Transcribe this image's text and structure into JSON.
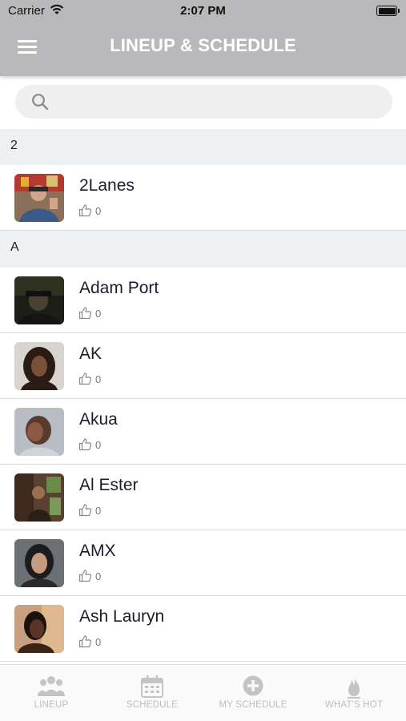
{
  "status_bar": {
    "carrier": "Carrier",
    "time": "2:07 PM"
  },
  "header": {
    "title": "LINEUP & SCHEDULE",
    "menu_icon": "hamburger-menu-icon"
  },
  "search": {
    "placeholder": "",
    "value": ""
  },
  "sections": [
    {
      "letter": "2",
      "artists": [
        {
          "name": "2Lanes",
          "likes": "0"
        }
      ]
    },
    {
      "letter": "A",
      "artists": [
        {
          "name": "Adam Port",
          "likes": "0"
        },
        {
          "name": "AK",
          "likes": "0"
        },
        {
          "name": "Akua",
          "likes": "0"
        },
        {
          "name": "Al Ester",
          "likes": "0"
        },
        {
          "name": "AMX",
          "likes": "0"
        },
        {
          "name": "Ash Lauryn",
          "likes": "0"
        }
      ]
    }
  ],
  "tabs": [
    {
      "label": "LINEUP",
      "icon": "people-icon"
    },
    {
      "label": "SCHEDULE",
      "icon": "calendar-icon"
    },
    {
      "label": "MY SCHEDULE",
      "icon": "plus-circle-icon"
    },
    {
      "label": "WHAT'S HOT",
      "icon": "flame-icon"
    }
  ],
  "colors": {
    "header_bg": "#b9b9bb",
    "section_bg": "#eff0f1",
    "tab_inactive": "#bdbdbd"
  }
}
